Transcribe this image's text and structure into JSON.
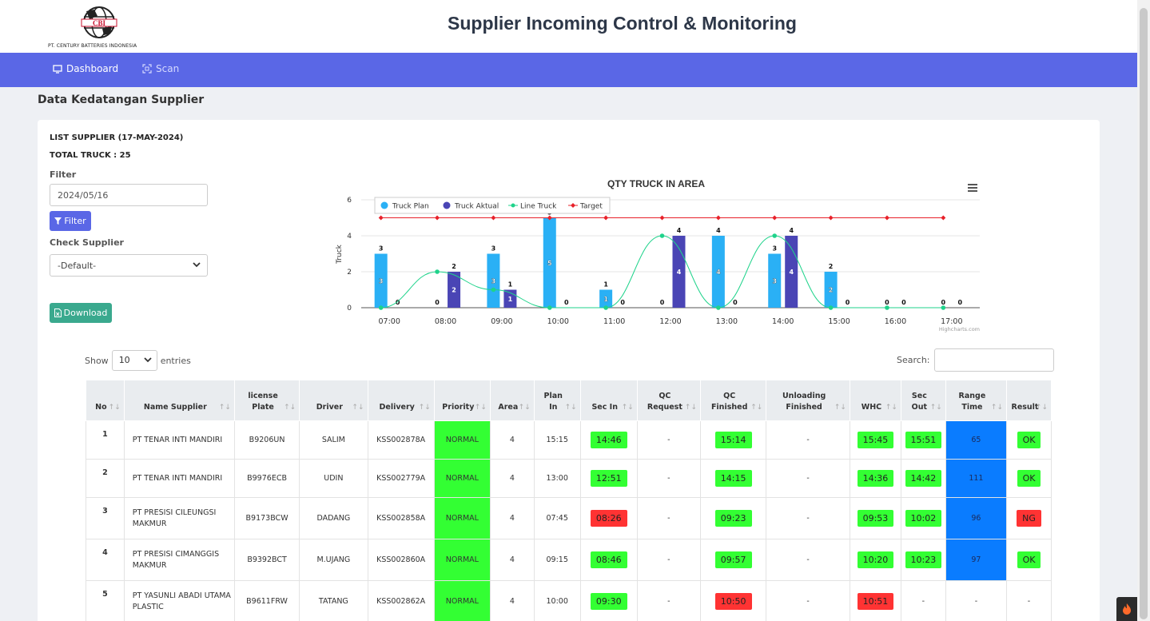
{
  "header": {
    "logo_letters": "CBI",
    "logo_text": "PT. CENTURY BATTERIES INDONESIA",
    "title": "Supplier Incoming Control & Monitoring"
  },
  "nav": {
    "items": [
      {
        "label": "Dashboard",
        "icon": "monitor-icon",
        "active": true
      },
      {
        "label": "Scan",
        "icon": "scan-icon",
        "active": false
      }
    ]
  },
  "page": {
    "heading": "Data Kedatangan Supplier",
    "list_supplier": "LIST SUPPLIER (17-MAY-2024)",
    "total_truck": "TOTAL TRUCK : 25",
    "filter_label": "Filter",
    "filter_date": "2024/05/16",
    "filter_button": "Filter",
    "check_supplier_label": "Check Supplier",
    "supplier_select": "-Default-",
    "download_button": "Download"
  },
  "colors": {
    "accent": "#5a67e6",
    "download": "#3aa98e",
    "ok_green": "#33ff33",
    "ng_red": "#ff3333",
    "range_blue": "#0a7cff",
    "truck_plan": "#2ab0f5",
    "truck_aktual": "#4a45b5",
    "line_truck": "#1fd38b",
    "target": "#e8212a"
  },
  "chart_data": {
    "type": "bar",
    "title": "QTY TRUCK IN AREA",
    "ylabel": "Truck",
    "xlabel": "",
    "ylim": [
      0,
      6
    ],
    "yticks": [
      0,
      2,
      4,
      6
    ],
    "categories": [
      "07:00",
      "08:00",
      "09:00",
      "10:00",
      "11:00",
      "12:00",
      "13:00",
      "14:00",
      "15:00",
      "16:00",
      "17:00"
    ],
    "series": [
      {
        "name": "Truck Plan",
        "kind": "bar",
        "values": [
          3,
          0,
          3,
          5,
          1,
          0,
          4,
          3,
          2,
          0,
          0
        ]
      },
      {
        "name": "Truck Aktual",
        "kind": "bar",
        "values": [
          0,
          2,
          1,
          0,
          0,
          4,
          0,
          4,
          0,
          0,
          0
        ]
      },
      {
        "name": "Line Truck",
        "kind": "spline",
        "values": [
          0,
          2,
          1,
          0,
          0,
          4,
          0,
          4,
          0,
          0,
          0
        ]
      },
      {
        "name": "Target",
        "kind": "line",
        "values": [
          5,
          5,
          5,
          5,
          5,
          5,
          5,
          5,
          5,
          5,
          5
        ]
      }
    ],
    "legend": "top-left",
    "grid": true,
    "credits": "Highcharts.com"
  },
  "table_controls": {
    "show_label": "Show",
    "entries_value": "10",
    "entries_label": "entries",
    "search_label": "Search:"
  },
  "table": {
    "headers": [
      {
        "l1": "",
        "l2": "No"
      },
      {
        "l1": "",
        "l2": "Name Supplier"
      },
      {
        "l1": "license",
        "l2": "Plate"
      },
      {
        "l1": "",
        "l2": "Driver"
      },
      {
        "l1": "",
        "l2": "Delivery"
      },
      {
        "l1": "",
        "l2": "Priority"
      },
      {
        "l1": "",
        "l2": "Area"
      },
      {
        "l1": "Plan",
        "l2": "In"
      },
      {
        "l1": "",
        "l2": "Sec In"
      },
      {
        "l1": "QC",
        "l2": "Request"
      },
      {
        "l1": "QC",
        "l2": "Finished"
      },
      {
        "l1": "Unloading",
        "l2": "Finished"
      },
      {
        "l1": "",
        "l2": "WHC"
      },
      {
        "l1": "Sec",
        "l2": "Out"
      },
      {
        "l1": "Range",
        "l2": "Time"
      },
      {
        "l1": "",
        "l2": "Result"
      }
    ],
    "rows": [
      {
        "no": "1",
        "supplier": "PT TENAR INTI MANDIRI",
        "plate": "B9206UN",
        "driver": "SALIM",
        "delivery": "KSS002878A",
        "priority": "NORMAL",
        "area": "4",
        "plan_in": "15:15",
        "sec_in": "14:46",
        "sec_in_status": "g",
        "qc_req": "-",
        "qc_fin": "15:14",
        "qc_fin_status": "g",
        "unload": "-",
        "whc": "15:45",
        "whc_status": "g",
        "sec_out": "15:51",
        "sec_out_status": "g",
        "range": "65",
        "result": "OK",
        "result_status": "g"
      },
      {
        "no": "2",
        "supplier": "PT TENAR INTI MANDIRI",
        "plate": "B9976ECB",
        "driver": "UDIN",
        "delivery": "KSS002779A",
        "priority": "NORMAL",
        "area": "4",
        "plan_in": "13:00",
        "sec_in": "12:51",
        "sec_in_status": "g",
        "qc_req": "-",
        "qc_fin": "14:15",
        "qc_fin_status": "g",
        "unload": "-",
        "whc": "14:36",
        "whc_status": "g",
        "sec_out": "14:42",
        "sec_out_status": "g",
        "range": "111",
        "result": "OK",
        "result_status": "g"
      },
      {
        "no": "3",
        "supplier": "PT PRESISI CILEUNGSI MAKMUR",
        "plate": "B9173BCW",
        "driver": "DADANG",
        "delivery": "KSS002858A",
        "priority": "NORMAL",
        "area": "4",
        "plan_in": "07:45",
        "sec_in": "08:26",
        "sec_in_status": "r",
        "qc_req": "-",
        "qc_fin": "09:23",
        "qc_fin_status": "g",
        "unload": "-",
        "whc": "09:53",
        "whc_status": "g",
        "sec_out": "10:02",
        "sec_out_status": "g",
        "range": "96",
        "result": "NG",
        "result_status": "r"
      },
      {
        "no": "4",
        "supplier": "PT PRESISI CIMANGGIS MAKMUR",
        "plate": "B9392BCT",
        "driver": "M.UJANG",
        "delivery": "KSS002860A",
        "priority": "NORMAL",
        "area": "4",
        "plan_in": "09:15",
        "sec_in": "08:46",
        "sec_in_status": "g",
        "qc_req": "-",
        "qc_fin": "09:57",
        "qc_fin_status": "g",
        "unload": "-",
        "whc": "10:20",
        "whc_status": "g",
        "sec_out": "10:23",
        "sec_out_status": "g",
        "range": "97",
        "result": "OK",
        "result_status": "g"
      },
      {
        "no": "5",
        "supplier": "PT YASUNLI ABADI UTAMA PLASTIC",
        "plate": "B9611FRW",
        "driver": "TATANG",
        "delivery": "KSS002862A",
        "priority": "NORMAL",
        "area": "4",
        "plan_in": "10:00",
        "sec_in": "09:30",
        "sec_in_status": "g",
        "qc_req": "-",
        "qc_fin": "10:50",
        "qc_fin_status": "r",
        "unload": "-",
        "whc": "10:51",
        "whc_status": "r",
        "sec_out": "-",
        "sec_out_status": "",
        "range": "-",
        "result": "-",
        "result_status": ""
      }
    ]
  }
}
